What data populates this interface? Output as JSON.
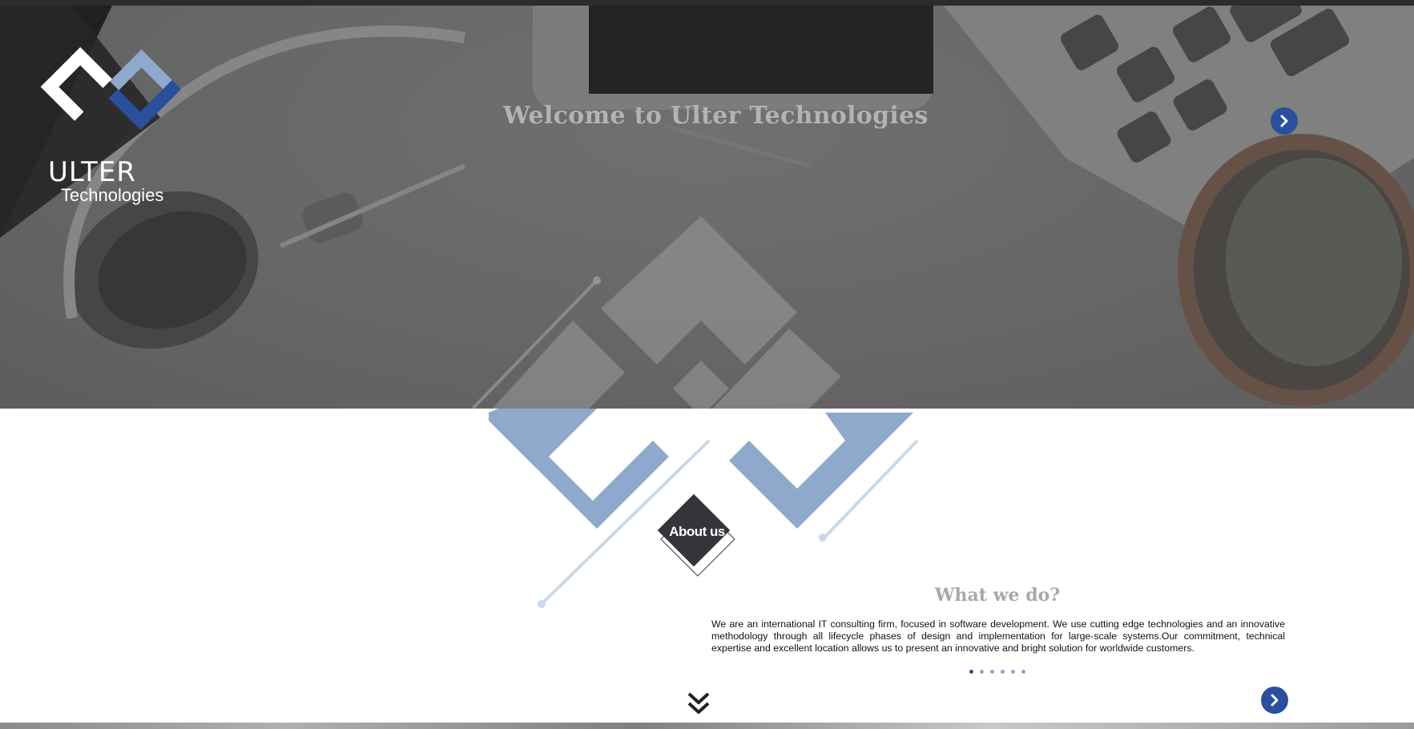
{
  "brand": {
    "word": "ULTER",
    "sub": "Technologies",
    "accent": "#2a4f9c",
    "light_accent": "#8fa9cc"
  },
  "hero": {
    "title": "Welcome to Ulter Technologies",
    "next_icon": "chevron-right-icon"
  },
  "about": {
    "label": "About us"
  },
  "section": {
    "title": "What we do?",
    "text": "We are an international IT consulting firm, focused in software development. We use cutting edge technologies and an innovative methodology through all lifecycle phases of design and implementation for large-scale systems.Our commitment, technical expertise and excellent location allows us to present an innovative and bright solution for worldwide customers.",
    "dots_count": 6,
    "active_dot": 0,
    "next_icon": "chevron-right-icon"
  },
  "scroll": {
    "icon": "double-chevron-down-icon"
  }
}
